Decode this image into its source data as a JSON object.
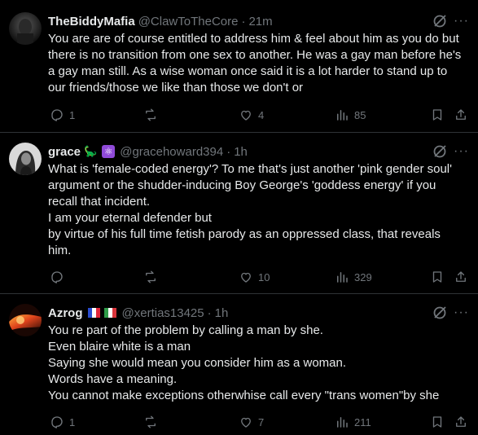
{
  "tweets": [
    {
      "name": "TheBiddyMafia",
      "handle": "@ClawToTheCore",
      "separator": "·",
      "time": "21m",
      "badges": [],
      "lines": [
        "You are are of course entitled to address him & feel about him as you do but",
        "there is no transition from one sex to another. He was a gay man before he's",
        "a gay man still. As a wise woman once said it is a lot harder to stand up to",
        "our friends/those we like than those we don't or"
      ],
      "replies": "1",
      "reposts": "",
      "likes": "4",
      "views": "85"
    },
    {
      "name": "grace",
      "handle": "@gracehoward394",
      "separator": "·",
      "time": "1h",
      "badges": [
        "🦕",
        "⚛"
      ],
      "lines": [
        "What is 'female-coded energy'? To me that's just another 'pink gender soul'",
        "argument or the shudder-inducing Boy George's 'goddess energy' if you",
        "recall that incident.",
        "I am your eternal defender but",
        "by virtue of his full time fetish parody as an oppressed class, that reveals",
        "him."
      ],
      "replies": "",
      "reposts": "",
      "likes": "10",
      "views": "329"
    },
    {
      "name": "Azrog",
      "handle": "@xertias13425",
      "separator": "·",
      "time": "1h",
      "badges": [
        "🇫🇷",
        "🇮🇹"
      ],
      "lines": [
        "You re part of the problem by calling a man by she.",
        "Even blaire white is a man",
        "Saying she would mean you consider him as a woman.",
        "Words have a meaning.",
        "You cannot make exceptions otherwhise call every \"trans women\"by she"
      ],
      "replies": "1",
      "reposts": "",
      "likes": "7",
      "views": "211"
    }
  ],
  "icons": {
    "grok": "grok-icon",
    "more": "more-icon",
    "reply": "reply-icon",
    "repost": "repost-icon",
    "like": "heart-icon",
    "views": "views-icon",
    "bookmark": "bookmark-icon",
    "share": "share-icon"
  },
  "colors": {
    "background": "#000000",
    "text": "#e7e9ea",
    "muted": "#71767b",
    "divider": "#2f3336"
  },
  "more_glyph": "···"
}
